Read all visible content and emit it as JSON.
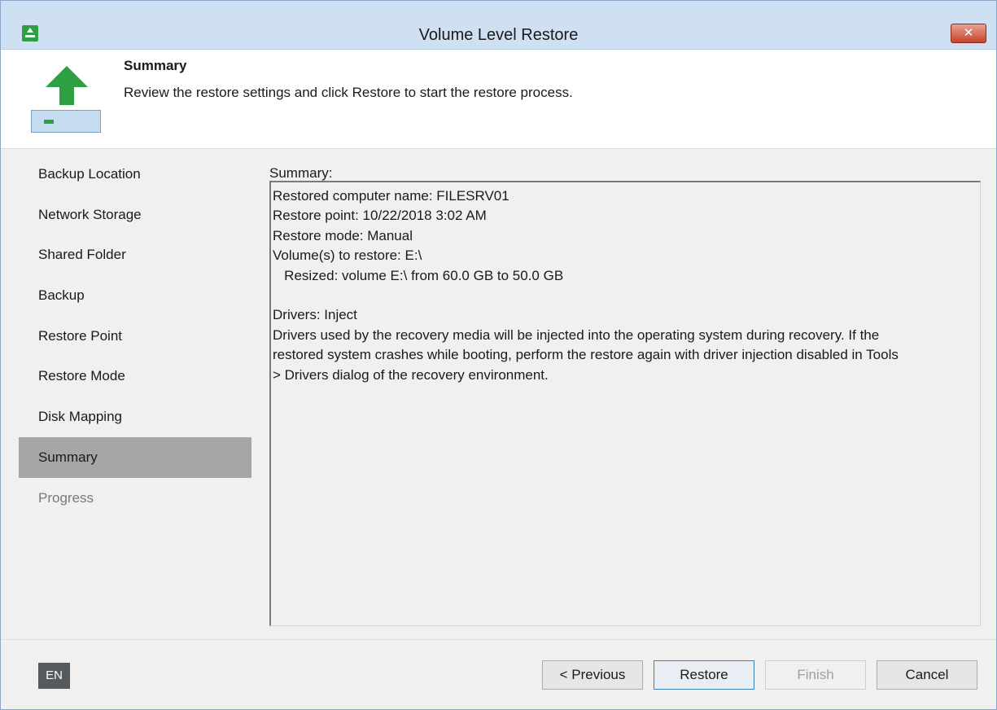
{
  "window": {
    "title": "Volume Level Restore",
    "close_label": "✕"
  },
  "header": {
    "title": "Summary",
    "description": "Review the restore settings and click Restore to start the restore process."
  },
  "sidebar": {
    "items": [
      {
        "label": "Backup Location",
        "state": "normal"
      },
      {
        "label": "Network Storage",
        "state": "normal"
      },
      {
        "label": "Shared Folder",
        "state": "normal"
      },
      {
        "label": "Backup",
        "state": "normal"
      },
      {
        "label": "Restore Point",
        "state": "normal"
      },
      {
        "label": "Restore Mode",
        "state": "normal"
      },
      {
        "label": "Disk Mapping",
        "state": "normal"
      },
      {
        "label": "Summary",
        "state": "active"
      },
      {
        "label": "Progress",
        "state": "disabled"
      }
    ]
  },
  "main": {
    "summary_label": "Summary:",
    "summary_lines": [
      "Restored computer name: FILESRV01",
      "Restore point: 10/22/2018 3:02 AM",
      "Restore mode: Manual",
      "Volume(s) to restore: E:\\",
      "   Resized: volume E:\\ from 60.0 GB to 50.0 GB",
      "",
      "Drivers: Inject",
      "Drivers used by the recovery media will be injected into the operating system during recovery. If the",
      "restored system crashes while booting, perform the restore again with driver injection disabled in Tools",
      "> Drivers dialog of the recovery environment."
    ]
  },
  "footer": {
    "language": "EN",
    "previous_label": "< Previous",
    "restore_label": "Restore",
    "finish_label": "Finish",
    "cancel_label": "Cancel"
  }
}
